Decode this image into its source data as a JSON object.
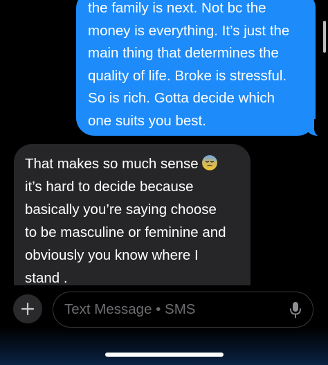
{
  "thread": {
    "outgoing": {
      "lines": [
        "the family is next. Not bc the",
        "money is everything. It’s just the",
        "main thing that determines the",
        "quality of life. Broke is stressful.",
        "So is rich. Gotta decide which",
        "one suits you best."
      ]
    },
    "incoming": {
      "lines": [
        "That makes so much sense",
        "it’s hard to decide because",
        "basically you’re saying choose",
        "to be masculine or feminine and",
        "obviously you know where I",
        "stand ."
      ],
      "emoji": "anxious-sweat-face"
    }
  },
  "composer": {
    "plus_label": "+",
    "placeholder": "Text Message • SMS",
    "mic_icon": "microphone-icon"
  },
  "colors": {
    "outgoing_bubble": "#1d8bfa",
    "incoming_bubble": "#262628",
    "background": "#000000",
    "placeholder_text": "#6d6d72"
  }
}
